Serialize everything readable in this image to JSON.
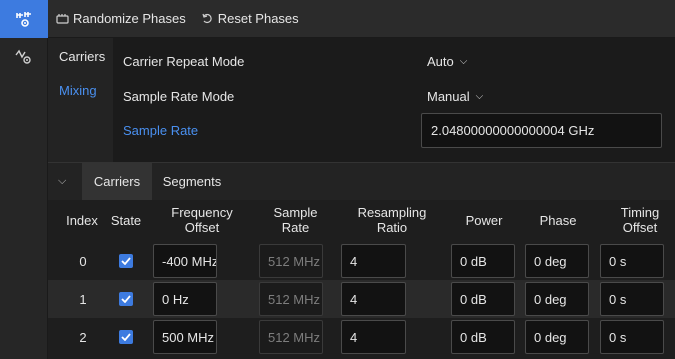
{
  "toolbar": {
    "randomize_label": "Randomize Phases",
    "reset_label": "Reset Phases"
  },
  "subnav": {
    "items": [
      {
        "label": "Carriers",
        "active": false
      },
      {
        "label": "Mixing",
        "active": true
      }
    ]
  },
  "settings": {
    "carrier_repeat_mode": {
      "label": "Carrier Repeat Mode",
      "value": "Auto"
    },
    "sample_rate_mode": {
      "label": "Sample Rate Mode",
      "value": "Manual"
    },
    "sample_rate": {
      "label": "Sample Rate",
      "value": "2.04800000000000004 GHz"
    }
  },
  "tabs": [
    {
      "label": "Carriers",
      "active": true
    },
    {
      "label": "Segments",
      "active": false
    }
  ],
  "table": {
    "columns": [
      "Index",
      "State",
      "Frequency\nOffset",
      "Sample\nRate",
      "Resampling\nRatio",
      "Power",
      "Phase",
      "Timing\nOffset"
    ],
    "rows": [
      {
        "index": "0",
        "state": true,
        "frequency_offset": "-400 MHz",
        "sample_rate": "512 MHz",
        "resampling_ratio": "4",
        "power": "0 dB",
        "phase": "0 deg",
        "timing_offset": "0 s"
      },
      {
        "index": "1",
        "state": true,
        "frequency_offset": "0 Hz",
        "sample_rate": "512 MHz",
        "resampling_ratio": "4",
        "power": "0 dB",
        "phase": "0 deg",
        "timing_offset": "0 s"
      },
      {
        "index": "2",
        "state": true,
        "frequency_offset": "500 MHz",
        "sample_rate": "512 MHz",
        "resampling_ratio": "4",
        "power": "0 dB",
        "phase": "0 deg",
        "timing_offset": "0 s"
      }
    ]
  },
  "colors": {
    "accent": "#3d7be0",
    "link": "#4a90f0",
    "background": "#1e1e1e"
  },
  "icons": {
    "rail_top": "carrier-settings-icon",
    "rail_second": "waveform-settings-icon",
    "randomize": "dice-icon",
    "reset": "reset-icon",
    "collapse": "chevron-down-icon",
    "dropdown": "chevron-down-icon",
    "check": "checkmark-icon"
  }
}
